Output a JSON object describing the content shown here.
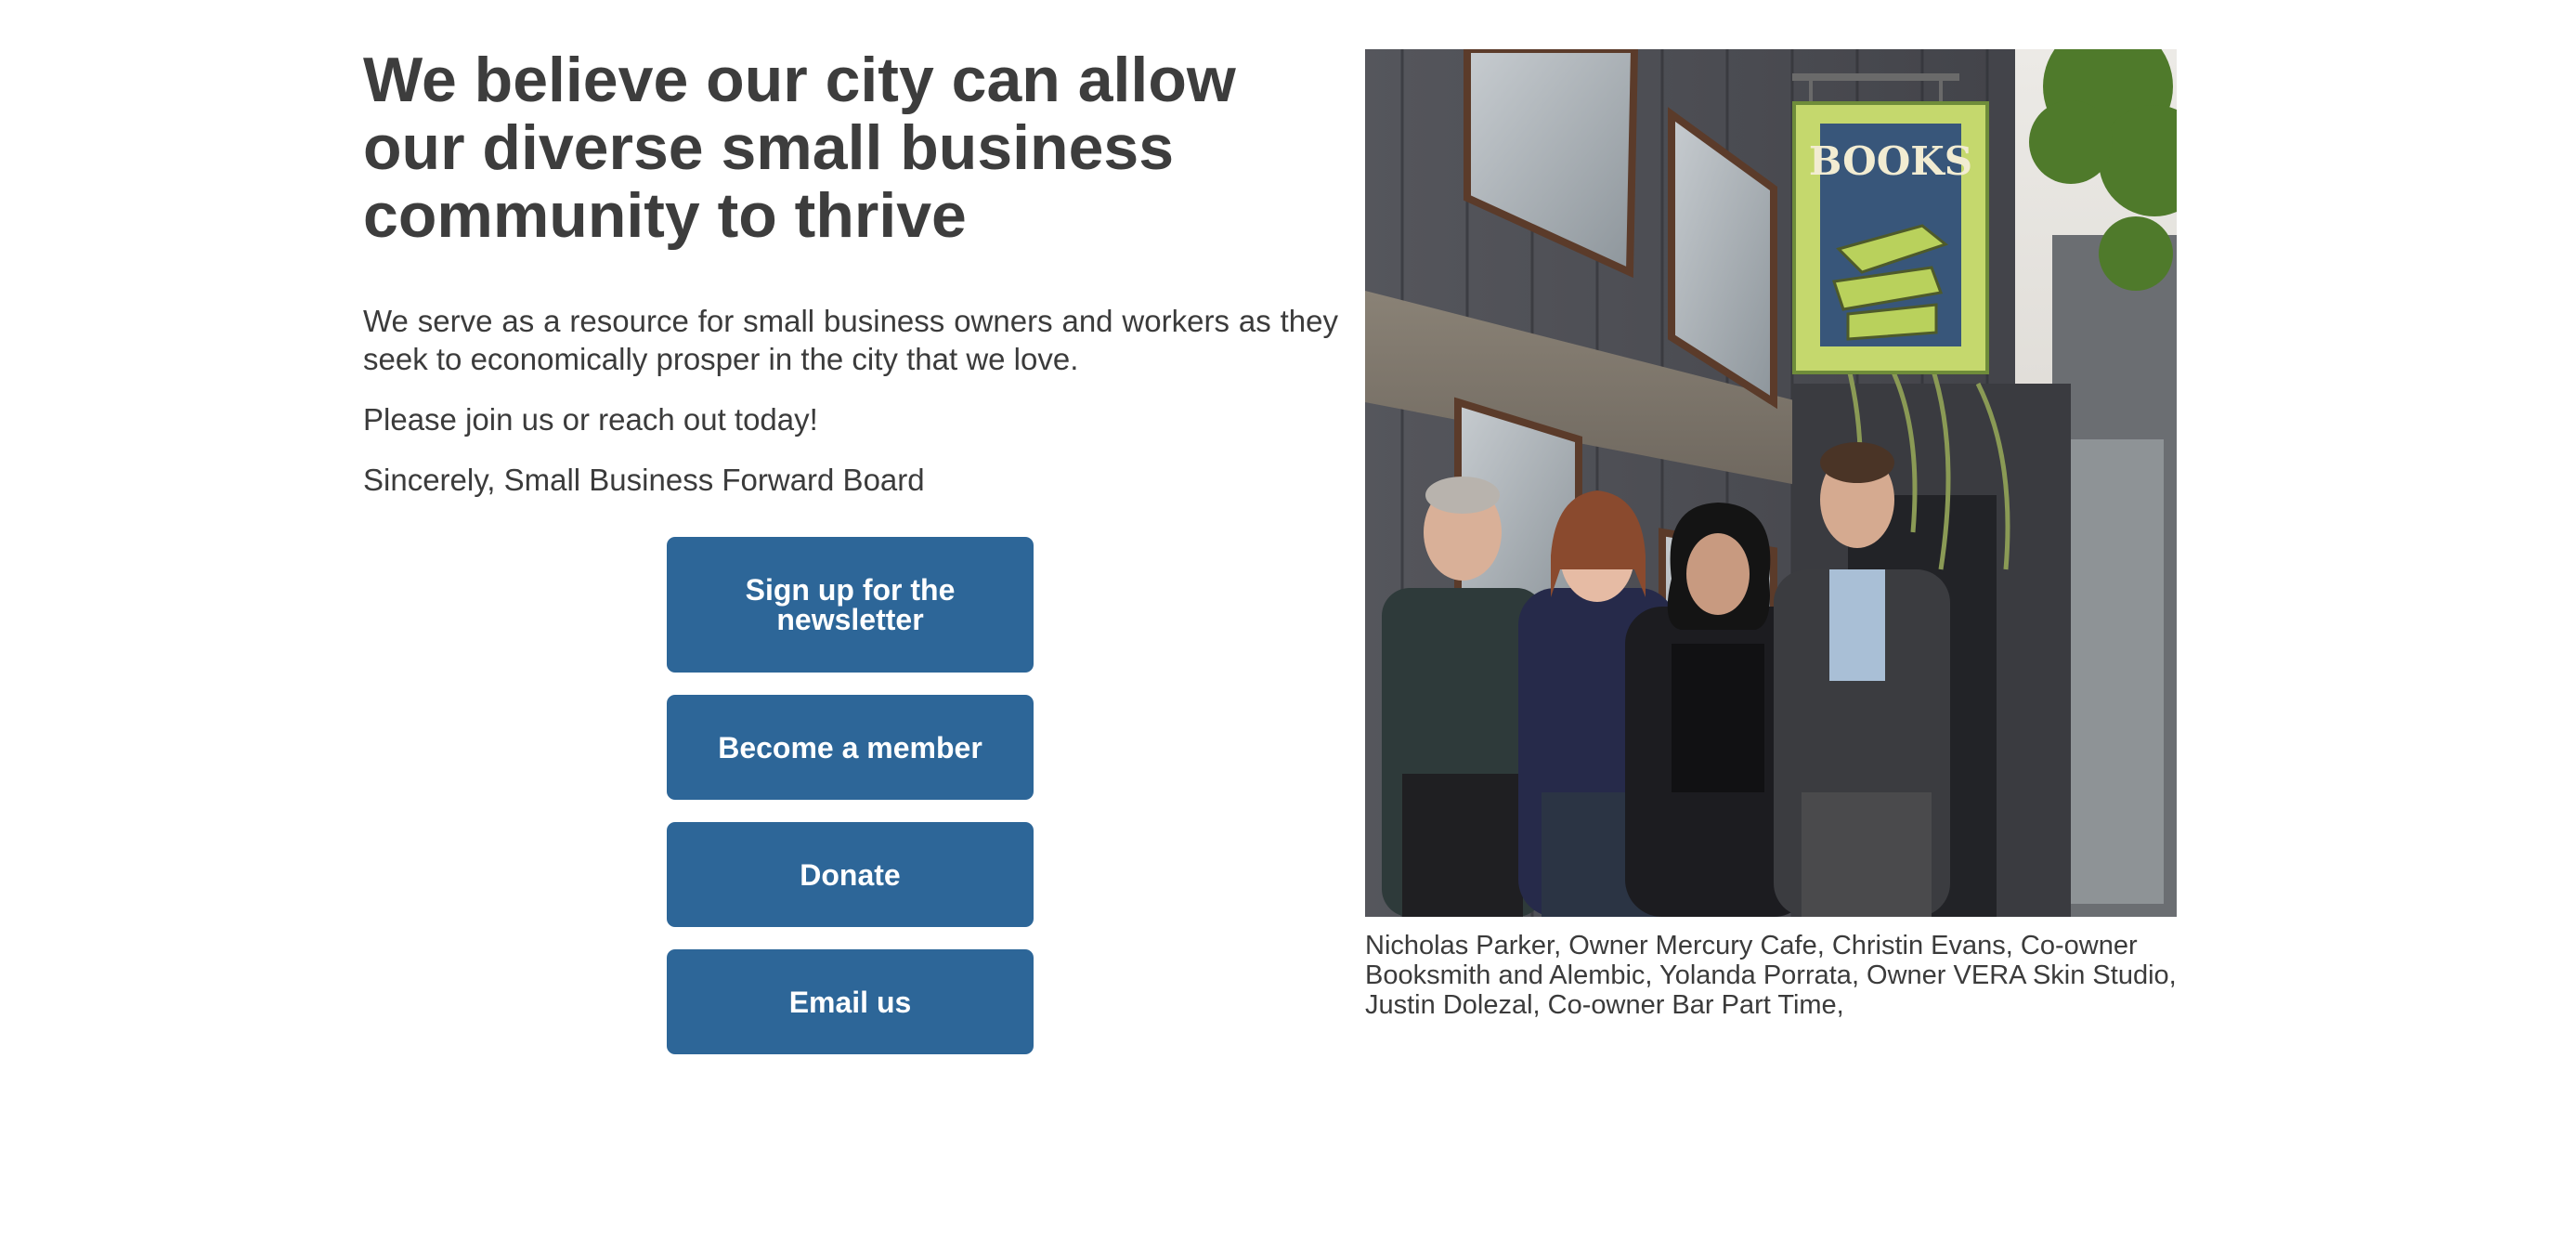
{
  "headline": "We believe our city can allow our diverse small business community to thrive",
  "intro": "We serve as a resource for small business owners and workers as they seek to economically prosper in the city that we love.",
  "join_text": "Please join us or reach out today!",
  "signoff": "Sincerely, Small Business Forward Board",
  "buttons": {
    "newsletter": "Sign up for the newsletter",
    "member": "Become a member",
    "donate": "Donate",
    "email": "Email us"
  },
  "photo": {
    "sign_text": "BOOKS"
  },
  "caption": "Nicholas Parker, Owner Mercury Cafe, Christin Evans, Co-owner Booksmith and Alembic, Yolanda Porrata, Owner VERA Skin Studio, Justin Dolezal, Co-owner Bar Part Time,",
  "colors": {
    "button_bg": "#2d6698",
    "button_text": "#ffffff",
    "text": "#3b3b3b"
  }
}
